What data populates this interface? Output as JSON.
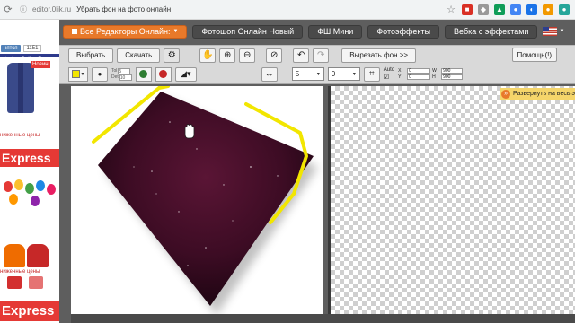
{
  "browser": {
    "domain": "editor.0lik.ru",
    "title": "Убрать фон на фото онлайн"
  },
  "ads": {
    "vk_label": "нятся",
    "vk_count": "1151",
    "shop_name": "otoshopOnline.Ru",
    "new_badge": "Новин",
    "promo_1": "ниженные цены",
    "express_1": "Express",
    "promo_2": "ниженные цены",
    "express_2": "Express"
  },
  "nav": {
    "all_editors": "Все Редакторы Онлайн:",
    "photoshop_new": "Фотошоп Онлайн Новый",
    "fsh_mini": "ФШ Мини",
    "photo_effects": "Фотоэффекты",
    "webcam_effects": "Вебка с эффектами"
  },
  "toolbar": {
    "select_label": "Выбрать",
    "download_label": "Скачать",
    "cut_bg_label": "Вырезать фон >>",
    "help_label": "Помощь(!)",
    "tol_label": "Tol",
    "tol_value": "5",
    "det_label": "Det",
    "det_value": "10",
    "brush_size": "5",
    "brush_value": "0",
    "auto_label": "Auto",
    "x_label": "X",
    "x_value": "0",
    "w_label": "W",
    "w_value": "900",
    "y_label": "Y",
    "y_value": "0",
    "h_label": "H",
    "h_value": "900",
    "arrows_icon": "↔",
    "expand_label": "Развернуть на весь э"
  },
  "colors": {
    "accent": "#e8792a",
    "selection_outline": "#f2e600",
    "shape_fill": "#4a0f2a"
  }
}
